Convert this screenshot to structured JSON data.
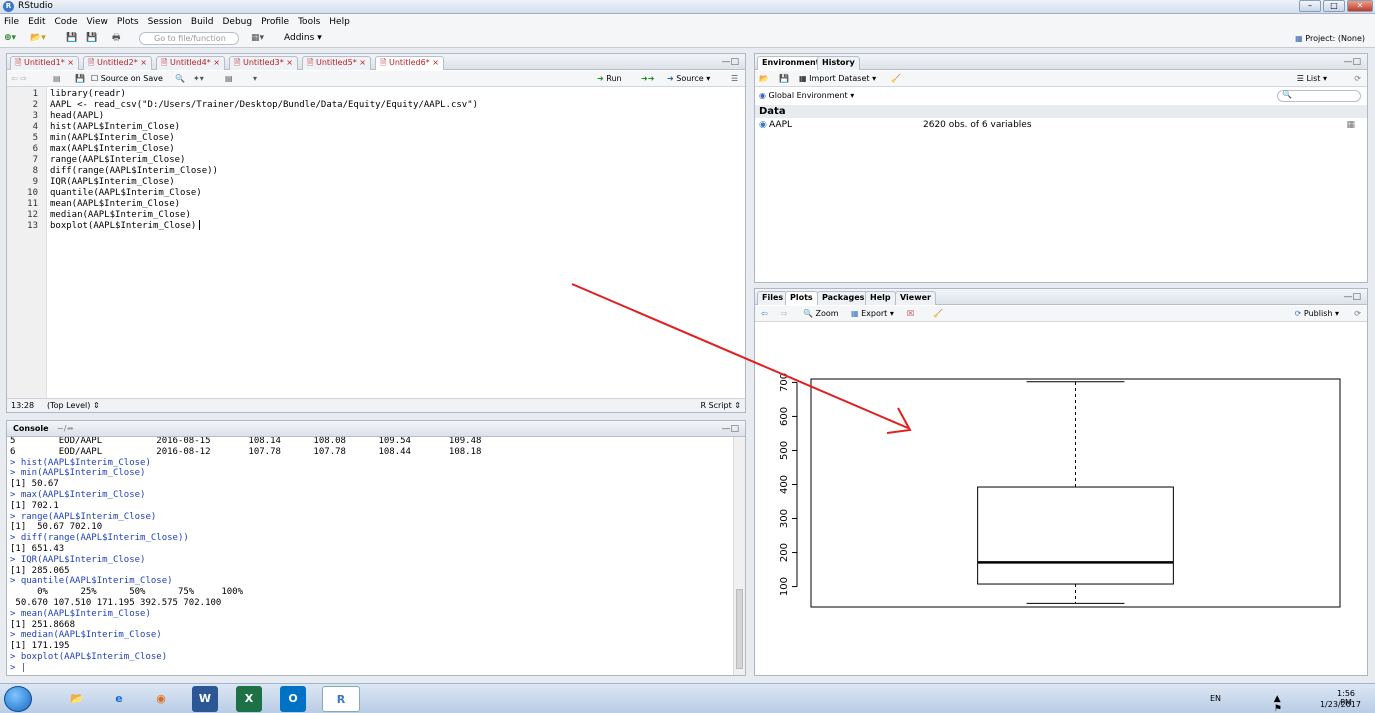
{
  "window": {
    "title": "RStudio"
  },
  "menu": [
    "File",
    "Edit",
    "Code",
    "View",
    "Plots",
    "Session",
    "Build",
    "Debug",
    "Profile",
    "Tools",
    "Help"
  ],
  "toolbar": {
    "goto_placeholder": "Go to file/function",
    "addins": "Addins",
    "project": "Project: (None)"
  },
  "editor": {
    "tabs": [
      "Untitled1*",
      "Untitled2*",
      "Untitled4*",
      "Untitled3*",
      "Untitled5*",
      "Untitled6*"
    ],
    "source_on_save": "Source on Save",
    "run": "Run",
    "source": "Source",
    "lines": [
      "library(readr)",
      "AAPL <- read_csv(\"D:/Users/Trainer/Desktop/Bundle/Data/Equity/Equity/AAPL.csv\")",
      "head(AAPL)",
      "hist(AAPL$Interim_Close)",
      "min(AAPL$Interim_Close)",
      "max(AAPL$Interim_Close)",
      "range(AAPL$Interim_Close)",
      "diff(range(AAPL$Interim_Close))",
      "IQR(AAPL$Interim_Close)",
      "quantile(AAPL$Interim_Close)",
      "mean(AAPL$Interim_Close)",
      "median(AAPL$Interim_Close)",
      "boxplot(AAPL$Interim_Close)"
    ],
    "line_numbers": [
      "1",
      "2",
      "3",
      "4",
      "5",
      "6",
      "7",
      "8",
      "9",
      "10",
      "11",
      "12",
      "13"
    ],
    "status_pos": "13:28",
    "status_level": "(Top Level) ⇕",
    "status_type": "R Script ⇕"
  },
  "console": {
    "title": "Console",
    "path": "~/",
    "lines": [
      {
        "t": "5        EOD/AAPL          2016-08-15       108.14      108.08      109.54       109.48",
        "k": "out"
      },
      {
        "t": "6        EOD/AAPL          2016-08-12       107.78      107.78      108.44       108.18",
        "k": "out"
      },
      {
        "t": "> hist(AAPL$Interim_Close)",
        "k": "cmd"
      },
      {
        "t": "> min(AAPL$Interim_Close)",
        "k": "cmd"
      },
      {
        "t": "[1] 50.67",
        "k": "out"
      },
      {
        "t": "> max(AAPL$Interim_Close)",
        "k": "cmd"
      },
      {
        "t": "[1] 702.1",
        "k": "out"
      },
      {
        "t": "> range(AAPL$Interim_Close)",
        "k": "cmd"
      },
      {
        "t": "[1]  50.67 702.10",
        "k": "out"
      },
      {
        "t": "> diff(range(AAPL$Interim_Close))",
        "k": "cmd"
      },
      {
        "t": "[1] 651.43",
        "k": "out"
      },
      {
        "t": "> IQR(AAPL$Interim_Close)",
        "k": "cmd"
      },
      {
        "t": "[1] 285.065",
        "k": "out"
      },
      {
        "t": "> quantile(AAPL$Interim_Close)",
        "k": "cmd"
      },
      {
        "t": "     0%      25%      50%      75%     100%",
        "k": "out"
      },
      {
        "t": " 50.670 107.510 171.195 392.575 702.100",
        "k": "out"
      },
      {
        "t": "> mean(AAPL$Interim_Close)",
        "k": "cmd"
      },
      {
        "t": "[1] 251.8668",
        "k": "out"
      },
      {
        "t": "> median(AAPL$Interim_Close)",
        "k": "cmd"
      },
      {
        "t": "[1] 171.195",
        "k": "out"
      },
      {
        "t": "> boxplot(AAPL$Interim_Close)",
        "k": "cmd"
      },
      {
        "t": "> |",
        "k": "cmd"
      }
    ]
  },
  "environment": {
    "tabs": [
      "Environment",
      "History"
    ],
    "import_dataset": "Import Dataset",
    "list_view": "List",
    "global_env": "Global Environment",
    "section": "Data",
    "object_name": "AAPL",
    "object_desc": "2620 obs. of 6 variables"
  },
  "files_pane": {
    "tabs": [
      "Files",
      "Plots",
      "Packages",
      "Help",
      "Viewer"
    ],
    "zoom": "Zoom",
    "export": "Export",
    "publish": "Publish"
  },
  "chart_data": {
    "type": "boxplot",
    "title": "",
    "xlabel": "",
    "ylabel": "",
    "ylim": [
      40,
      710
    ],
    "yticks": [
      "100",
      "200",
      "300",
      "400",
      "500",
      "600",
      "700"
    ],
    "y_tick_values": [
      100,
      200,
      300,
      400,
      500,
      600,
      700
    ],
    "min": 50.67,
    "q1": 107.51,
    "median": 171.195,
    "q3": 392.575,
    "max": 702.1,
    "grid": false
  },
  "taskbar": {
    "lang": "EN",
    "time": "1:56 PM",
    "date": "1/23/2017"
  },
  "colors": {
    "command": "#2040c0",
    "annotation_arrow": "#e02020",
    "selected_tab": "#ffffff"
  }
}
